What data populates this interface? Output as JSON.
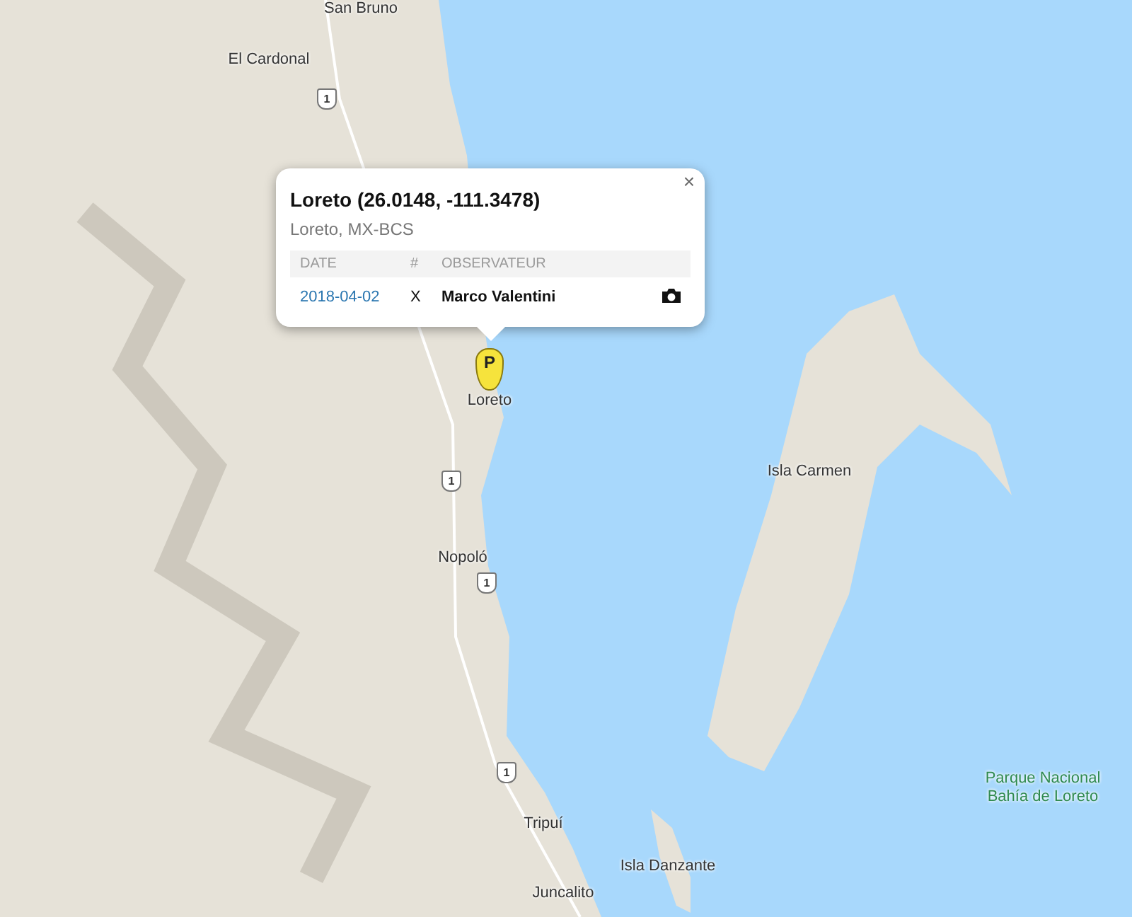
{
  "map": {
    "labels": [
      {
        "text": "San Bruno",
        "kind": "town"
      },
      {
        "text": "El Cardonal",
        "kind": "town"
      },
      {
        "text": "Loreto",
        "kind": "town"
      },
      {
        "text": "Nopoló",
        "kind": "town"
      },
      {
        "text": "Isla Carmen",
        "kind": "town"
      },
      {
        "text": "Tripuí",
        "kind": "town"
      },
      {
        "text": "Isla Danzante",
        "kind": "town"
      },
      {
        "text": "Juncalito",
        "kind": "town"
      },
      {
        "text": "Parque Nacional Bahía de Loreto",
        "kind": "park"
      }
    ],
    "shields": [
      "1",
      "1",
      "1",
      "1"
    ],
    "marker": {
      "letter": "P"
    }
  },
  "popup": {
    "title": "Loreto (26.0148, -111.3478)",
    "subtitle": "Loreto, MX-BCS",
    "close": "×",
    "columns": [
      "DATE",
      "#",
      "OBSERVATEUR"
    ],
    "rows": [
      {
        "date": "2018-04-02",
        "count": "X",
        "observer": "Marco Valentini",
        "photo": true
      }
    ]
  }
}
